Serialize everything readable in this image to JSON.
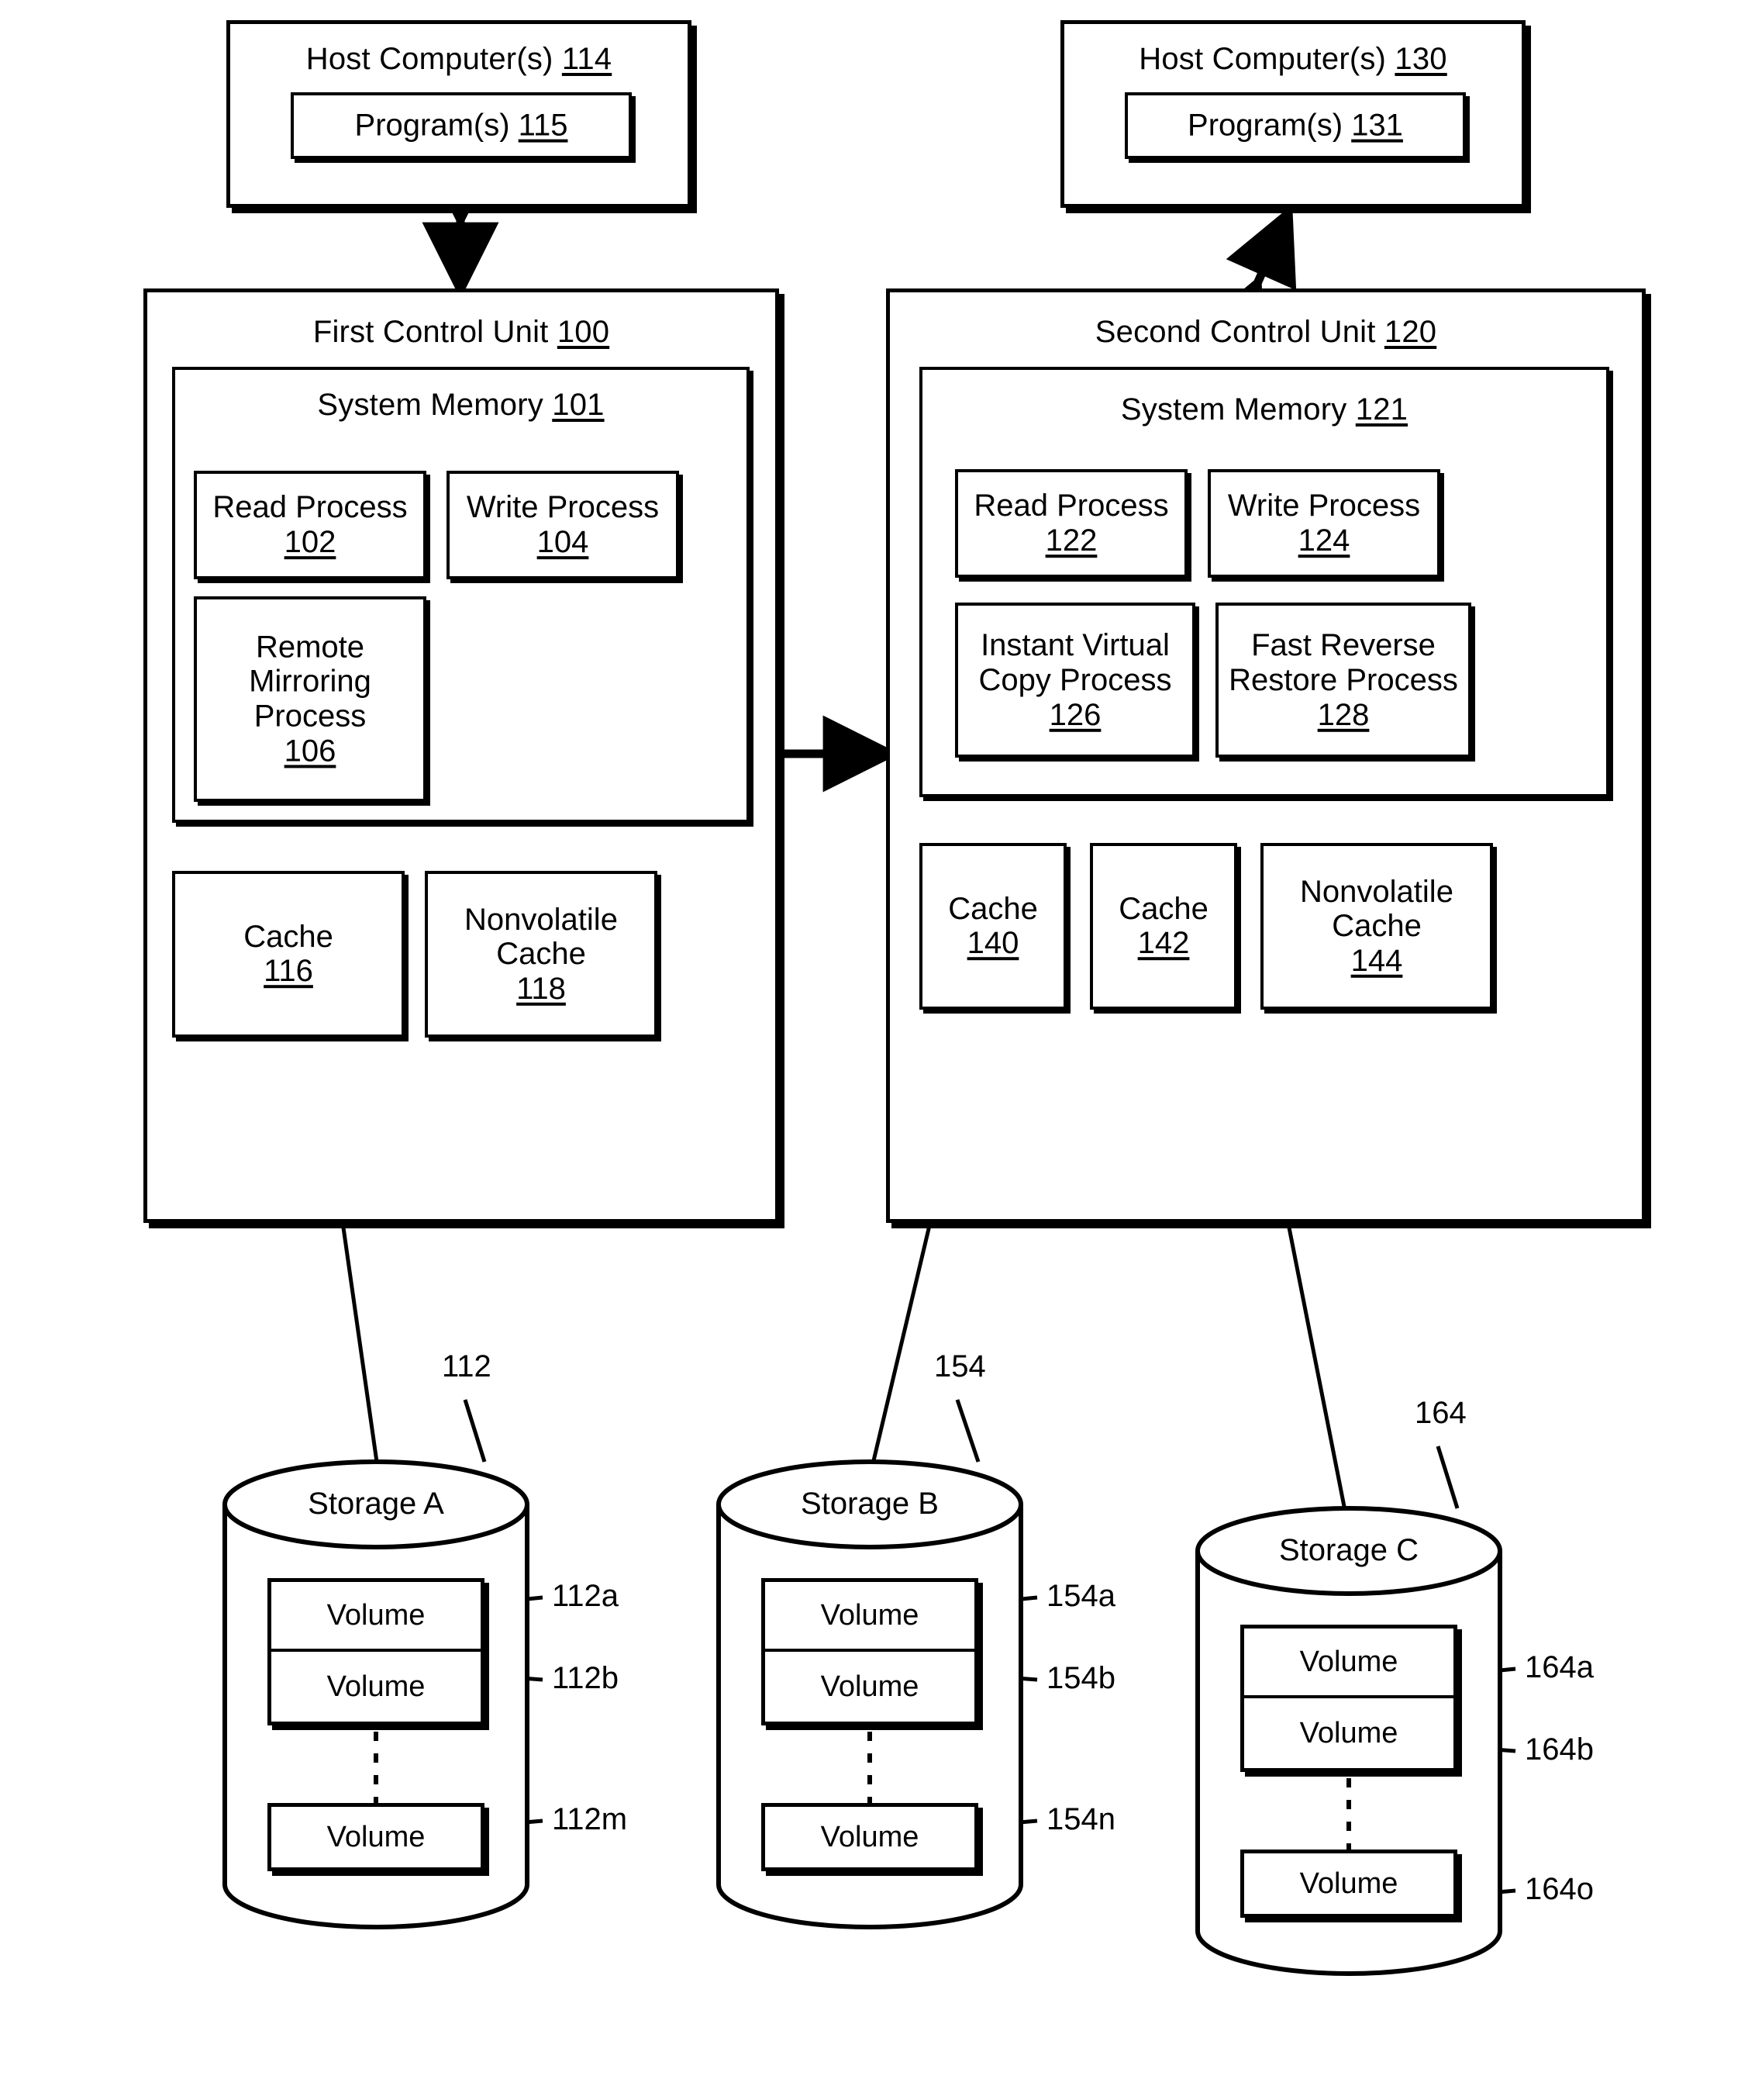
{
  "figure": {
    "hosts": [
      {
        "id": "host-114",
        "title": "Host Computer(s) 114",
        "title_text": "Host Computer(s) ",
        "title_num": "114",
        "program": "Program(s) 115",
        "program_text": "Program(s) ",
        "program_num": "115"
      },
      {
        "id": "host-130",
        "title": "Host Computer(s) 130",
        "title_text": "Host Computer(s) ",
        "title_num": "130",
        "program": "Program(s) 131",
        "program_text": "Program(s) ",
        "program_num": "131"
      }
    ],
    "control_units": [
      {
        "id": "first-control-unit",
        "title_text": "First Control Unit ",
        "title_num": "100",
        "memory_text": "System Memory ",
        "memory_num": "101",
        "processes": [
          {
            "label": "Read Process",
            "num": "102"
          },
          {
            "label": "Write Process",
            "num": "104"
          },
          {
            "label": "Remote\nMirroring\nProcess",
            "line1": "Remote",
            "line2": "Mirroring",
            "line3": "Process",
            "num": "106"
          }
        ],
        "caches": [
          {
            "label": "Cache",
            "num": "116",
            "inline": false
          },
          {
            "label": "Nonvolatile\nCache",
            "line1": "Nonvolatile",
            "line2": "Cache",
            "num": "118",
            "inline": false
          }
        ]
      },
      {
        "id": "second-control-unit",
        "title_text": "Second Control Unit ",
        "title_num": "120",
        "memory_text": "System Memory ",
        "memory_num": "121",
        "processes": [
          {
            "label": "Read Process",
            "num": "122"
          },
          {
            "label": "Write Process",
            "num": "124"
          },
          {
            "label": "Instant Virtual\nCopy Process",
            "line1": "Instant Virtual",
            "line2": "Copy Process",
            "num": "126"
          },
          {
            "label": "Fast Reverse\nRestore Process",
            "line1": "Fast Reverse",
            "line2": "Restore Process",
            "num": "128"
          }
        ],
        "caches": [
          {
            "label": "Cache",
            "num": "140",
            "inline": true
          },
          {
            "label": "Cache",
            "num": "142",
            "inline": true
          },
          {
            "label": "Nonvolatile\nCache",
            "line1": "Nonvolatile",
            "line2": "Cache",
            "num": "144",
            "inline": false
          }
        ]
      }
    ],
    "storages": [
      {
        "id": "storage-a",
        "name": "Storage A",
        "ref": "112",
        "volumes": [
          {
            "label": "Volume",
            "ref": "112a"
          },
          {
            "label": "Volume",
            "ref": "112b"
          },
          {
            "label": "Volume",
            "ref": "112m"
          }
        ]
      },
      {
        "id": "storage-b",
        "name": "Storage B",
        "ref": "154",
        "volumes": [
          {
            "label": "Volume",
            "ref": "154a"
          },
          {
            "label": "Volume",
            "ref": "154b"
          },
          {
            "label": "Volume",
            "ref": "154n"
          }
        ]
      },
      {
        "id": "storage-c",
        "name": "Storage C",
        "ref": "164",
        "volumes": [
          {
            "label": "Volume",
            "ref": "164a"
          },
          {
            "label": "Volume",
            "ref": "164b"
          },
          {
            "label": "Volume",
            "ref": "164o"
          }
        ]
      }
    ],
    "colors": {
      "ink": "#000000",
      "paper": "#ffffff"
    }
  }
}
